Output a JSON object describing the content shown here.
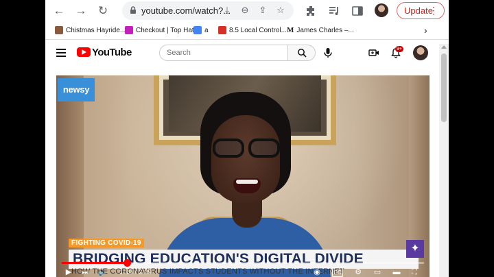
{
  "browser": {
    "url": "youtube.com/watch?...",
    "update_label": "Update",
    "bookmarks": [
      {
        "label": "Chistmas Hayride...",
        "color": "#8a5a3c"
      },
      {
        "label": "Checkout | Top Hat",
        "color": "#c21fbd"
      },
      {
        "label": "a",
        "color": "#4285f4"
      },
      {
        "label": "8.5 Local Control...",
        "color": "#d93025"
      },
      {
        "label": "James Charles –...",
        "color": "#000000"
      }
    ]
  },
  "youtube": {
    "brand": "YouTube",
    "search_placeholder": "Search",
    "notification_count": "9+"
  },
  "video": {
    "channel_logo": "newsy",
    "tag": "FIGHTING COVID-19",
    "headline": "BRIDGING EDUCATION'S DIGITAL DIVIDE",
    "subheadline": "HOW THE CORONAVIRUS IMPACTS STUDENTS WITHOUT THE INTERNET",
    "time_display": "1:10 / 2:29",
    "progress": 0.18,
    "accent": "#ff0000"
  }
}
